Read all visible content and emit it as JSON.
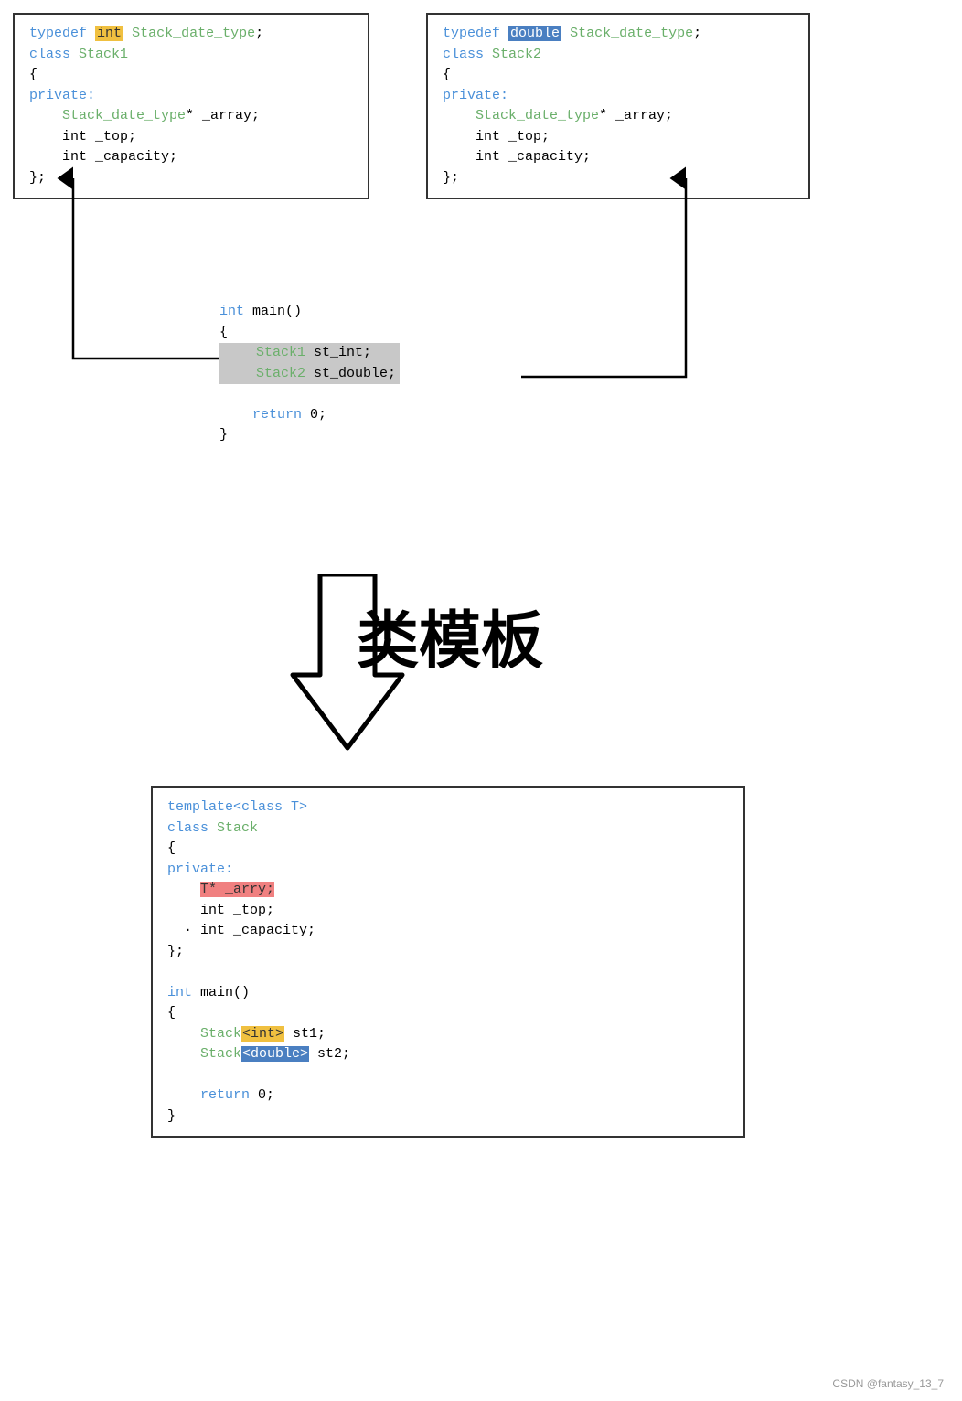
{
  "box1": {
    "lines": [
      {
        "type": "typedef",
        "text_before": "typedef ",
        "highlight": "int",
        "highlight_class": "kw-int-highlight",
        "text_after": " Stack_date_type;"
      },
      {
        "type": "plain_blue",
        "text": "class Stack1"
      },
      {
        "type": "plain",
        "text": "{"
      },
      {
        "type": "plain_blue",
        "text": "private:"
      },
      {
        "type": "indent_green",
        "text": "    Stack_date_type* _array;"
      },
      {
        "type": "indent_plain",
        "text": "    int _top;"
      },
      {
        "type": "indent_plain",
        "text": "    int _capacity;"
      },
      {
        "type": "plain",
        "text": "};"
      }
    ]
  },
  "box2": {
    "lines": [
      {
        "type": "typedef",
        "text_before": "typedef ",
        "highlight": "double",
        "highlight_class": "kw-double-highlight",
        "text_after": " Stack_date_type;"
      },
      {
        "type": "plain_blue",
        "text": "class Stack2"
      },
      {
        "type": "plain",
        "text": "{"
      },
      {
        "type": "plain_blue",
        "text": "private:"
      },
      {
        "type": "indent_green",
        "text": "    Stack_date_type* _array;"
      },
      {
        "type": "indent_plain",
        "text": "    int _top;"
      },
      {
        "type": "indent_plain",
        "text": "    int _capacity;"
      },
      {
        "type": "plain",
        "text": "};"
      }
    ]
  },
  "middle": {
    "lines": [
      {
        "type": "int_main",
        "text_blue": "int",
        "text_after": " main()"
      },
      {
        "type": "plain",
        "text": "{"
      },
      {
        "type": "highlighted",
        "text": "    Stack1 st_int;"
      },
      {
        "type": "highlighted",
        "text": "    Stack2 st_double;"
      },
      {
        "type": "plain",
        "text": ""
      },
      {
        "type": "return",
        "text_blue": "    return",
        "text_after": " 0;"
      },
      {
        "type": "plain",
        "text": "}"
      }
    ]
  },
  "label": "类模板",
  "box3": {
    "lines": [
      {
        "type": "plain_blue",
        "text": "template<class T>"
      },
      {
        "type": "plain_blue",
        "text": "class Stack"
      },
      {
        "type": "plain",
        "text": "{"
      },
      {
        "type": "plain_blue",
        "text": "private:"
      },
      {
        "type": "highlighted_pink",
        "text": "    T* _arry;"
      },
      {
        "type": "indent_plain",
        "text": "    int _top;"
      },
      {
        "type": "indent_dot",
        "text": "  · int _capacity;"
      },
      {
        "type": "plain",
        "text": "};"
      },
      {
        "type": "plain",
        "text": ""
      },
      {
        "type": "int_main",
        "text_blue": "int",
        "text_after": " main()"
      },
      {
        "type": "plain",
        "text": "{"
      },
      {
        "type": "stack_int",
        "text_green": "    Stack",
        "highlight": "<int>",
        "highlight_class": "kw-int-inline",
        "text_after": " st1;"
      },
      {
        "type": "stack_double",
        "text_green": "    Stack",
        "highlight": "<double>",
        "highlight_class": "kw-double-inline",
        "text_after": " st2;"
      },
      {
        "type": "plain",
        "text": ""
      },
      {
        "type": "return",
        "text_blue": "    return",
        "text_after": " 0;"
      },
      {
        "type": "plain",
        "text": "}"
      }
    ]
  },
  "watermark": "CSDN @fantasy_13_7"
}
